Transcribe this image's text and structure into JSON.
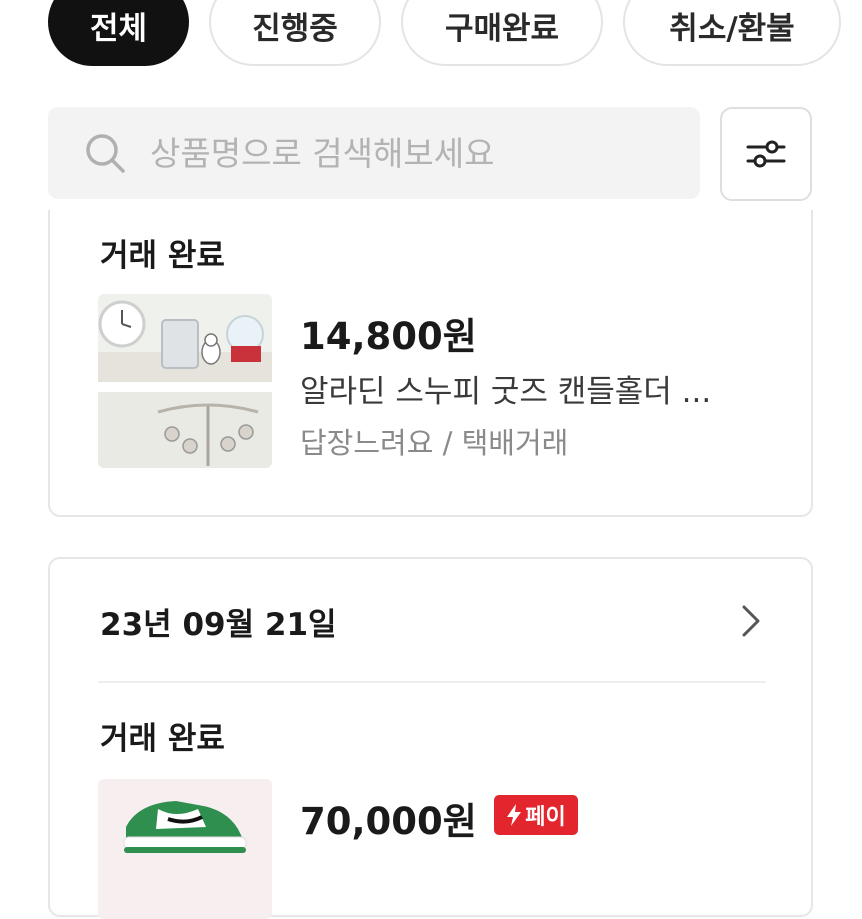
{
  "tabs": [
    {
      "label": "전체",
      "active": true
    },
    {
      "label": "진행중",
      "active": false
    },
    {
      "label": "구매완료",
      "active": false
    },
    {
      "label": "취소/환불",
      "active": false
    }
  ],
  "search": {
    "placeholder": "상품명으로 검색해보세요",
    "icon": "search-icon"
  },
  "filter": {
    "icon": "sliders-icon"
  },
  "orders": [
    {
      "status": "거래 완료",
      "price": "14,800원",
      "title": "알라딘 스누피 굿즈 캔들홀더 ...",
      "subtitle": "답장느려요 / 택배거래"
    },
    {
      "date": "23년 09월 21일",
      "status": "거래 완료",
      "price": "70,000원",
      "pay_badge": "페이"
    }
  ],
  "colors": {
    "accent": "#111111",
    "pay_red": "#e3262d",
    "muted": "#8a8a8a"
  }
}
